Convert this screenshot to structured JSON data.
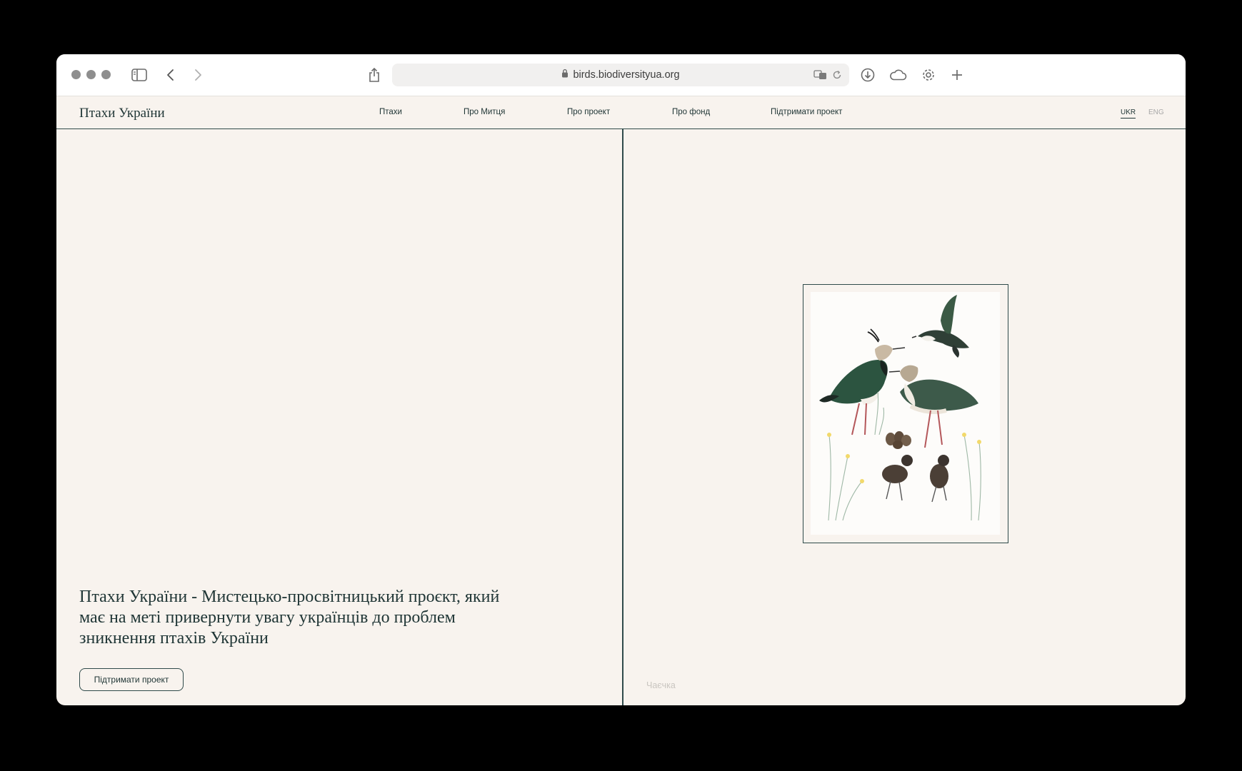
{
  "browser": {
    "url": "birds.biodiversityua.org"
  },
  "site": {
    "logo": "Птахи України",
    "nav": [
      {
        "label": "Птахи"
      },
      {
        "label": "Про Митця"
      },
      {
        "label": "Про проект"
      },
      {
        "label": "Про фонд"
      },
      {
        "label": "Підтримати проект"
      }
    ],
    "languages": {
      "active": "UKR",
      "inactive": "ENG"
    }
  },
  "hero": {
    "headline": "Птахи України - Мистецько-просвітницький проєкт, який має на меті привернути увагу українців до проблем зникнення птахів України",
    "cta_label": "Підтримати проект"
  },
  "artwork": {
    "caption": "Чаєчка"
  },
  "colors": {
    "background": "#f8f3ee",
    "accent": "#2f4a4a",
    "text": "#1f3535"
  }
}
